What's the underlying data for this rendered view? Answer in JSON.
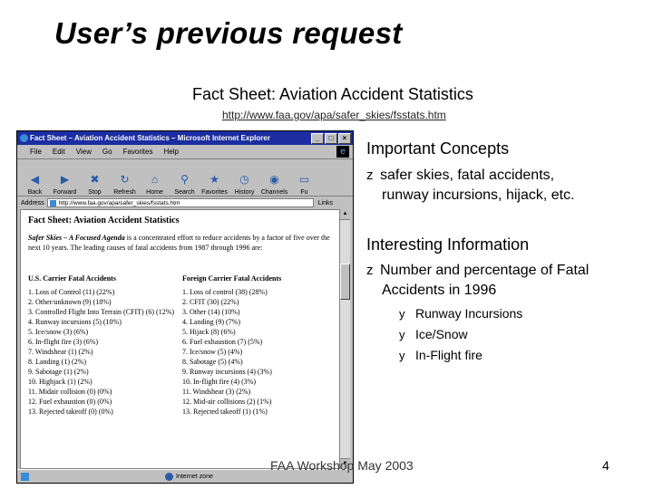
{
  "slide": {
    "title": "User’s previous request",
    "fact_title": "Fact Sheet: Aviation Accident Statistics",
    "url": "http://www.faa.gov/apa/safer_skies/fsstats.htm",
    "footer": "FAA Workshop May 2003",
    "page_number": "4"
  },
  "browser": {
    "window_title": "Fact Sheet – Aviation Accident Statistics – Microsoft Internet Explorer",
    "menu": [
      "File",
      "Edit",
      "View",
      "Go",
      "Favorites",
      "Help"
    ],
    "toolbar": [
      "Back",
      "Forward",
      "Stop",
      "Refresh",
      "Home",
      "Search",
      "Favorites",
      "History",
      "Channels",
      "Fu"
    ],
    "address_label": "Address",
    "address_value": "http://www.faa.gov/apa/safer_skies/fsstats.htm",
    "links_label": "Links",
    "status_text": "Internet zone",
    "page": {
      "heading": "Fact Sheet: Aviation Accident Statistics",
      "intro_bold": "Safer Skies – A Focused Agenda",
      "intro_rest": " is a concentrated effort to reduce accidents by a factor of five over the next 10 years. The leading causes of fatal accidents from 1987 through 1996 are:",
      "us_header": "U.S. Carrier Fatal Accidents",
      "foreign_header": "Foreign Carrier Fatal Accidents",
      "us_items": [
        "1. Loss of Control (11) (22%)",
        "2. Other/unknown (9) (18%)",
        "3. Controlled Flight Into Terrain (CFIT) (6) (12%)",
        "4. Runway incursions (5) (10%)",
        "5. Ice/snow (3) (6%)",
        "6. In-flight fire (3) (6%)",
        "7. Windshear (1) (2%)",
        "8. Landing (1) (2%)",
        "9. Sabotage (1) (2%)",
        "10. Highjack (1) (2%)",
        "11. Midair collision (0) (0%)",
        "12. Fuel exhaustion (0) (0%)",
        "13. Rejected takeoff (0) (0%)"
      ],
      "foreign_items": [
        "1. Loss of control (38) (28%)",
        "2. CFIT (30) (22%)",
        "3. Other (14) (10%)",
        "4. Landing (9) (7%)",
        "5. Hijack (8) (6%)",
        "6. Fuel exhaustion (7) (5%)",
        "7. Ice/snow (5) (4%)",
        "8. Sabotage (5) (4%)",
        "9. Runway incursions (4) (3%)",
        "10. In-flight fire (4) (3%)",
        "11. Windshear (3) (2%)",
        "12. Mid-air collisions (2) (1%)",
        "13. Rejected takeoff (1) (1%)"
      ]
    }
  },
  "panel": {
    "important_heading": "Important Concepts",
    "important_line1": "safer skies, fatal accidents,",
    "important_line2": "runway incursions, hijack, etc.",
    "interesting_heading": "Interesting Information",
    "interesting_line1": "Number and percentage of Fatal",
    "interesting_line2": "Accidents in 1996",
    "bullet_glyph": "z",
    "sub_glyph": "y",
    "sub_items": [
      "Runway Incursions",
      "Ice/Snow",
      "In-Flight fire"
    ]
  },
  "icons": {
    "window_buttons": [
      "minimize-icon",
      "maximize-icon",
      "close-icon"
    ],
    "toolbar_icons": [
      "back-arrow-icon",
      "forward-arrow-icon",
      "stop-icon",
      "refresh-icon",
      "home-icon",
      "search-icon",
      "favorites-icon",
      "history-icon",
      "channels-icon",
      "fullscreen-icon"
    ]
  }
}
